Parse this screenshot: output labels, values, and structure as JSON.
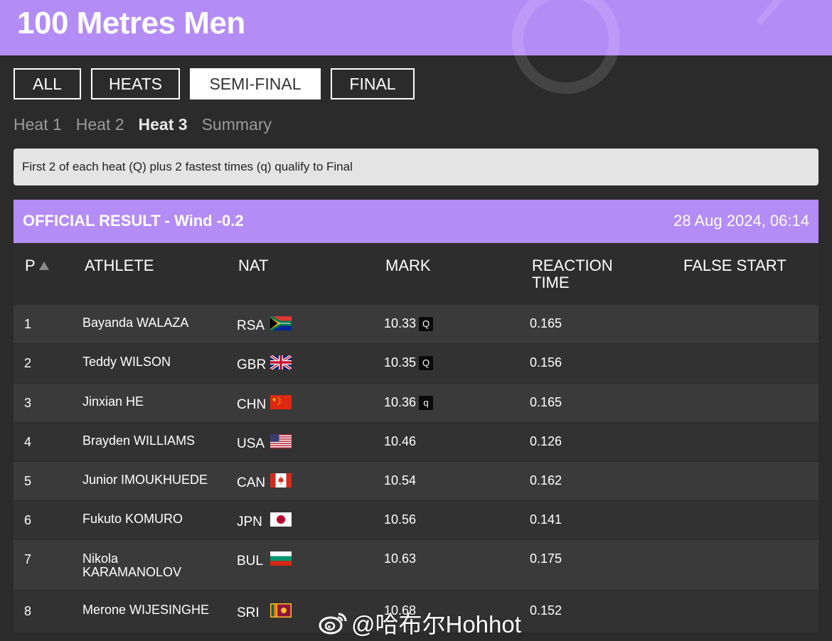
{
  "header": {
    "title": "100 Metres Men"
  },
  "round_tabs": [
    "ALL",
    "HEATS",
    "SEMI-FINAL",
    "FINAL"
  ],
  "active_round": "SEMI-FINAL",
  "heat_tabs": [
    "Heat 1",
    "Heat 2",
    "Heat 3",
    "Summary"
  ],
  "active_heat": "Heat 3",
  "notice": "First 2 of each heat (Q) plus 2 fastest times (q) qualify to Final",
  "result": {
    "title": "OFFICIAL RESULT - Wind -0.2",
    "datetime": "28 Aug 2024, 06:14"
  },
  "columns": {
    "pos": "P",
    "athlete": "ATHLETE",
    "nat": "NAT",
    "mark": "MARK",
    "reaction_line1": "REACTION",
    "reaction_line2": "TIME",
    "false_start": "FALSE START"
  },
  "rows": [
    {
      "pos": "1",
      "athlete": "Bayanda WALAZA",
      "nat": "RSA",
      "flag": "south-africa-flag",
      "mark": "10.33",
      "q": "Q",
      "reaction": "0.165"
    },
    {
      "pos": "2",
      "athlete": "Teddy WILSON",
      "nat": "GBR",
      "flag": "uk-flag",
      "mark": "10.35",
      "q": "Q",
      "reaction": "0.156"
    },
    {
      "pos": "3",
      "athlete": "Jinxian HE",
      "nat": "CHN",
      "flag": "china-flag",
      "mark": "10.36",
      "q": "q",
      "reaction": "0.165"
    },
    {
      "pos": "4",
      "athlete": "Brayden WILLIAMS",
      "nat": "USA",
      "flag": "usa-flag",
      "mark": "10.46",
      "q": "",
      "reaction": "0.126"
    },
    {
      "pos": "5",
      "athlete": "Junior IMOUKHUEDE",
      "nat": "CAN",
      "flag": "canada-flag",
      "mark": "10.54",
      "q": "",
      "reaction": "0.162"
    },
    {
      "pos": "6",
      "athlete": "Fukuto KOMURO",
      "nat": "JPN",
      "flag": "japan-flag",
      "mark": "10.56",
      "q": "",
      "reaction": "0.141"
    },
    {
      "pos": "7",
      "athlete": "Nikola KARAMANOLOV",
      "nat": "BUL",
      "flag": "bulgaria-flag",
      "mark": "10.63",
      "q": "",
      "reaction": "0.175"
    },
    {
      "pos": "8",
      "athlete": "Merone WIJESINGHE",
      "nat": "SRI",
      "flag": "sri-lanka-flag",
      "mark": "10.68",
      "q": "",
      "reaction": "0.152"
    }
  ],
  "watermark": "@哈布尔Hohhot",
  "colors": {
    "accent": "#b48cf6",
    "background": "#2b2b2b",
    "row_odd": "#3a3a3a",
    "row_even": "#323232"
  }
}
